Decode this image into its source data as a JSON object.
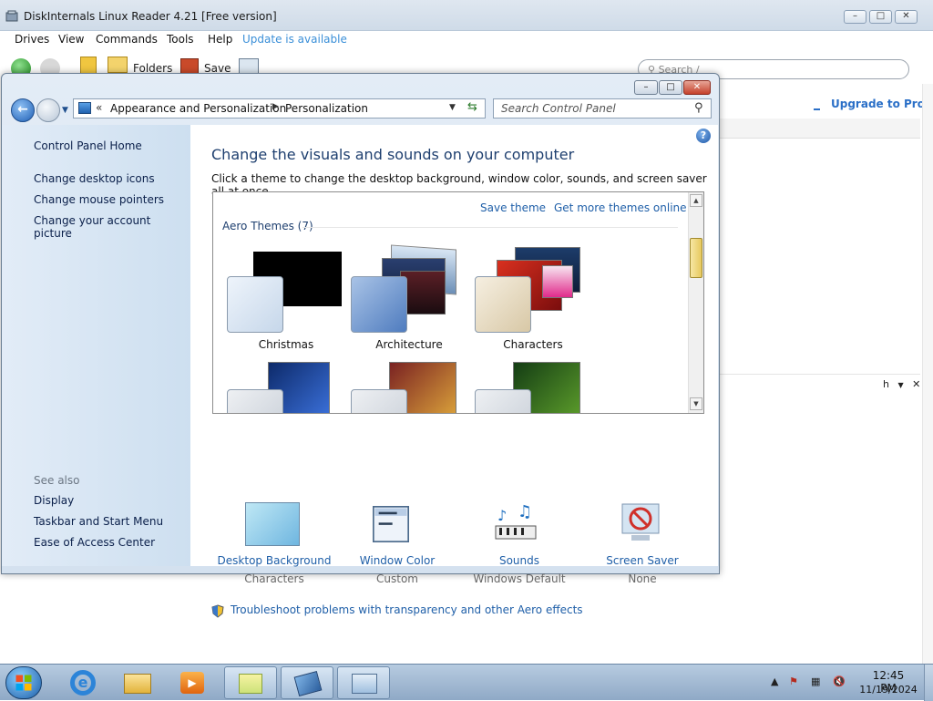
{
  "bg_app": {
    "title": "DiskInternals Linux Reader 4.21 [Free version]",
    "menu": [
      "Drives",
      "View",
      "Commands",
      "Tools",
      "Help"
    ],
    "update_link": "Update is available",
    "toolbar": {
      "folders": "Folders",
      "save": "Save"
    },
    "search_placeholder": "Search /",
    "upgrade": "Upgrade to Pro!",
    "panel_tag": "h"
  },
  "cp": {
    "breadcrumb": [
      "Appearance and Personalization",
      "Personalization"
    ],
    "breadcrumb_prefix": "«",
    "search_placeholder": "Search Control Panel",
    "left_links": [
      "Control Panel Home",
      "Change desktop icons",
      "Change mouse pointers",
      "Change your account picture"
    ],
    "see_also_label": "See also",
    "see_also_links": [
      "Display",
      "Taskbar and Start Menu",
      "Ease of Access Center"
    ],
    "title": "Change the visuals and sounds on your computer",
    "subtitle": "Click a theme to change the desktop background, window color, sounds, and screen saver all at once.",
    "save_theme": "Save theme",
    "more_themes": "Get more themes online",
    "aero_label": "Aero Themes (7)",
    "themes": [
      "Christmas",
      "Architecture",
      "Characters"
    ],
    "options": [
      {
        "title": "Desktop Background",
        "sub": "Characters"
      },
      {
        "title": "Window Color",
        "sub": "Custom"
      },
      {
        "title": "Sounds",
        "sub": "Windows Default"
      },
      {
        "title": "Screen Saver",
        "sub": "None"
      }
    ],
    "troubleshoot": "Troubleshoot problems with transparency and other Aero effects",
    "help_glyph": "?"
  },
  "taskbar": {
    "time": "12:45 PM",
    "date": "11/19/2024"
  },
  "colors": {
    "link": "#1f5fa8",
    "heading": "#1e3f6f",
    "close": "#c5412b"
  }
}
